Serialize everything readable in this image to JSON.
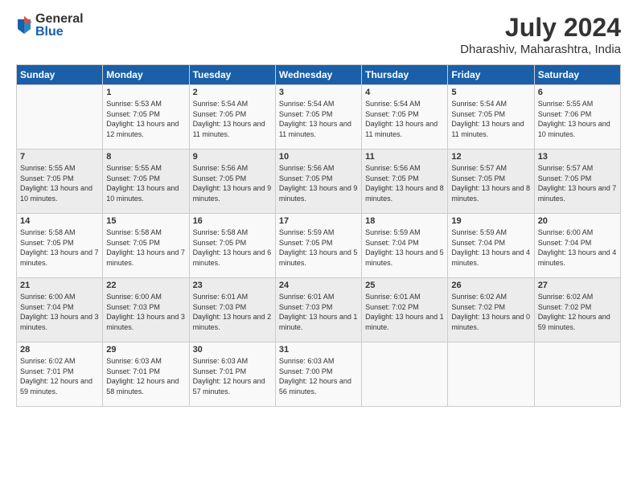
{
  "logo": {
    "general": "General",
    "blue": "Blue"
  },
  "header": {
    "title": "July 2024",
    "subtitle": "Dharashiv, Maharashtra, India"
  },
  "calendar": {
    "columns": [
      "Sunday",
      "Monday",
      "Tuesday",
      "Wednesday",
      "Thursday",
      "Friday",
      "Saturday"
    ],
    "rows": [
      [
        {
          "day": "",
          "content": ""
        },
        {
          "day": "1",
          "content": "Sunrise: 5:53 AM\nSunset: 7:05 PM\nDaylight: 13 hours and 12 minutes."
        },
        {
          "day": "2",
          "content": "Sunrise: 5:54 AM\nSunset: 7:05 PM\nDaylight: 13 hours and 11 minutes."
        },
        {
          "day": "3",
          "content": "Sunrise: 5:54 AM\nSunset: 7:05 PM\nDaylight: 13 hours and 11 minutes."
        },
        {
          "day": "4",
          "content": "Sunrise: 5:54 AM\nSunset: 7:05 PM\nDaylight: 13 hours and 11 minutes."
        },
        {
          "day": "5",
          "content": "Sunrise: 5:54 AM\nSunset: 7:05 PM\nDaylight: 13 hours and 11 minutes."
        },
        {
          "day": "6",
          "content": "Sunrise: 5:55 AM\nSunset: 7:06 PM\nDaylight: 13 hours and 10 minutes."
        }
      ],
      [
        {
          "day": "7",
          "content": "Sunrise: 5:55 AM\nSunset: 7:05 PM\nDaylight: 13 hours and 10 minutes."
        },
        {
          "day": "8",
          "content": "Sunrise: 5:55 AM\nSunset: 7:05 PM\nDaylight: 13 hours and 10 minutes."
        },
        {
          "day": "9",
          "content": "Sunrise: 5:56 AM\nSunset: 7:05 PM\nDaylight: 13 hours and 9 minutes."
        },
        {
          "day": "10",
          "content": "Sunrise: 5:56 AM\nSunset: 7:05 PM\nDaylight: 13 hours and 9 minutes."
        },
        {
          "day": "11",
          "content": "Sunrise: 5:56 AM\nSunset: 7:05 PM\nDaylight: 13 hours and 8 minutes."
        },
        {
          "day": "12",
          "content": "Sunrise: 5:57 AM\nSunset: 7:05 PM\nDaylight: 13 hours and 8 minutes."
        },
        {
          "day": "13",
          "content": "Sunrise: 5:57 AM\nSunset: 7:05 PM\nDaylight: 13 hours and 7 minutes."
        }
      ],
      [
        {
          "day": "14",
          "content": "Sunrise: 5:58 AM\nSunset: 7:05 PM\nDaylight: 13 hours and 7 minutes."
        },
        {
          "day": "15",
          "content": "Sunrise: 5:58 AM\nSunset: 7:05 PM\nDaylight: 13 hours and 7 minutes."
        },
        {
          "day": "16",
          "content": "Sunrise: 5:58 AM\nSunset: 7:05 PM\nDaylight: 13 hours and 6 minutes."
        },
        {
          "day": "17",
          "content": "Sunrise: 5:59 AM\nSunset: 7:05 PM\nDaylight: 13 hours and 5 minutes."
        },
        {
          "day": "18",
          "content": "Sunrise: 5:59 AM\nSunset: 7:04 PM\nDaylight: 13 hours and 5 minutes."
        },
        {
          "day": "19",
          "content": "Sunrise: 5:59 AM\nSunset: 7:04 PM\nDaylight: 13 hours and 4 minutes."
        },
        {
          "day": "20",
          "content": "Sunrise: 6:00 AM\nSunset: 7:04 PM\nDaylight: 13 hours and 4 minutes."
        }
      ],
      [
        {
          "day": "21",
          "content": "Sunrise: 6:00 AM\nSunset: 7:04 PM\nDaylight: 13 hours and 3 minutes."
        },
        {
          "day": "22",
          "content": "Sunrise: 6:00 AM\nSunset: 7:03 PM\nDaylight: 13 hours and 3 minutes."
        },
        {
          "day": "23",
          "content": "Sunrise: 6:01 AM\nSunset: 7:03 PM\nDaylight: 13 hours and 2 minutes."
        },
        {
          "day": "24",
          "content": "Sunrise: 6:01 AM\nSunset: 7:03 PM\nDaylight: 13 hours and 1 minute."
        },
        {
          "day": "25",
          "content": "Sunrise: 6:01 AM\nSunset: 7:02 PM\nDaylight: 13 hours and 1 minute."
        },
        {
          "day": "26",
          "content": "Sunrise: 6:02 AM\nSunset: 7:02 PM\nDaylight: 13 hours and 0 minutes."
        },
        {
          "day": "27",
          "content": "Sunrise: 6:02 AM\nSunset: 7:02 PM\nDaylight: 12 hours and 59 minutes."
        }
      ],
      [
        {
          "day": "28",
          "content": "Sunrise: 6:02 AM\nSunset: 7:01 PM\nDaylight: 12 hours and 59 minutes."
        },
        {
          "day": "29",
          "content": "Sunrise: 6:03 AM\nSunset: 7:01 PM\nDaylight: 12 hours and 58 minutes."
        },
        {
          "day": "30",
          "content": "Sunrise: 6:03 AM\nSunset: 7:01 PM\nDaylight: 12 hours and 57 minutes."
        },
        {
          "day": "31",
          "content": "Sunrise: 6:03 AM\nSunset: 7:00 PM\nDaylight: 12 hours and 56 minutes."
        },
        {
          "day": "",
          "content": ""
        },
        {
          "day": "",
          "content": ""
        },
        {
          "day": "",
          "content": ""
        }
      ]
    ]
  }
}
